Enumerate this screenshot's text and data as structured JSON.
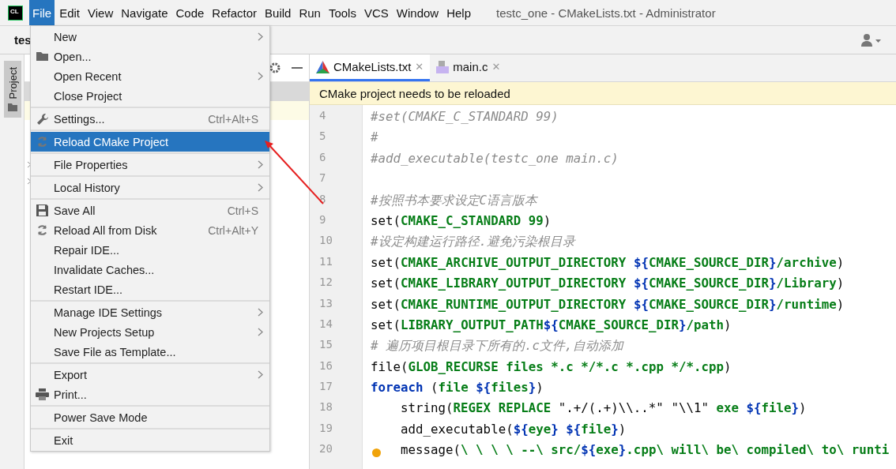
{
  "menu_bar": {
    "logo": "CL",
    "items": [
      {
        "label": "File",
        "selected": true
      },
      {
        "label": "Edit",
        "selected": false
      },
      {
        "label": "View",
        "selected": false
      },
      {
        "label": "Navigate",
        "selected": false
      },
      {
        "label": "Code",
        "selected": false
      },
      {
        "label": "Refactor",
        "selected": false
      },
      {
        "label": "Build",
        "selected": false
      },
      {
        "label": "Run",
        "selected": false
      },
      {
        "label": "Tools",
        "selected": false
      },
      {
        "label": "VCS",
        "selected": false
      },
      {
        "label": "Window",
        "selected": false
      },
      {
        "label": "Help",
        "selected": false
      }
    ],
    "window_title": "testc_one - CMakeLists.txt - Administrator"
  },
  "toolbar": {
    "project_name": "tes"
  },
  "side_strip": {
    "label": "Project"
  },
  "file_menu": {
    "sections": [
      [
        {
          "label": "New",
          "kind": "none",
          "submenu": true,
          "selected": false
        },
        {
          "label": "Open...",
          "kind": "folder",
          "submenu": false,
          "selected": false
        },
        {
          "label": "Open Recent",
          "kind": "none",
          "submenu": true,
          "selected": false
        },
        {
          "label": "Close Project",
          "kind": "none",
          "submenu": false,
          "selected": false
        }
      ],
      [
        {
          "label": "Settings...",
          "kind": "wrench",
          "shortcut": "Ctrl+Alt+S",
          "submenu": false,
          "selected": false
        }
      ],
      [
        {
          "label": "Reload CMake Project",
          "kind": "reload",
          "submenu": false,
          "selected": true
        }
      ],
      [
        {
          "label": "File Properties",
          "kind": "none",
          "submenu": true,
          "selected": false
        }
      ],
      [
        {
          "label": "Local History",
          "kind": "none",
          "submenu": true,
          "selected": false
        }
      ],
      [
        {
          "label": "Save All",
          "kind": "save",
          "shortcut": "Ctrl+S",
          "submenu": false,
          "selected": false
        },
        {
          "label": "Reload All from Disk",
          "kind": "reload",
          "shortcut": "Ctrl+Alt+Y",
          "submenu": false,
          "selected": false
        },
        {
          "label": "Repair IDE...",
          "kind": "none",
          "submenu": false,
          "selected": false
        },
        {
          "label": "Invalidate Caches...",
          "kind": "none",
          "submenu": false,
          "selected": false
        },
        {
          "label": "Restart IDE...",
          "kind": "none",
          "submenu": false,
          "selected": false
        }
      ],
      [
        {
          "label": "Manage IDE Settings",
          "kind": "none",
          "submenu": true,
          "selected": false
        },
        {
          "label": "New Projects Setup",
          "kind": "none",
          "submenu": true,
          "selected": false
        },
        {
          "label": "Save File as Template...",
          "kind": "none",
          "submenu": false,
          "selected": false
        }
      ],
      [
        {
          "label": "Export",
          "kind": "none",
          "submenu": true,
          "selected": false
        },
        {
          "label": "Print...",
          "kind": "printer",
          "submenu": false,
          "selected": false
        }
      ],
      [
        {
          "label": "Power Save Mode",
          "kind": "none",
          "submenu": false,
          "selected": false
        }
      ],
      [
        {
          "label": "Exit",
          "kind": "none",
          "submenu": false,
          "selected": false
        }
      ]
    ]
  },
  "editor": {
    "tabs": [
      {
        "label": "CMakeLists.txt",
        "kind": "cmake",
        "selected": true,
        "close": "✕"
      },
      {
        "label": "main.c",
        "kind": "c",
        "selected": false,
        "close": "✕"
      }
    ],
    "banner": "CMake project needs to be reloaded",
    "lines": [
      {
        "number": "4",
        "indented": false,
        "marker": false,
        "segments": [
          {
            "kind": "comment",
            "text": "#set(CMAKE_C_STANDARD 99)"
          }
        ]
      },
      {
        "number": "5",
        "indented": false,
        "marker": false,
        "segments": [
          {
            "kind": "comment",
            "text": "#"
          }
        ]
      },
      {
        "number": "6",
        "indented": false,
        "marker": false,
        "segments": [
          {
            "kind": "comment",
            "text": "#add_executable(testc_one main.c)"
          }
        ]
      },
      {
        "number": "7",
        "marker": false
      },
      {
        "number": "8",
        "indented": false,
        "marker": false,
        "segments": [
          {
            "kind": "comment",
            "text": "#按照书本要求设定C语言版本"
          }
        ]
      },
      {
        "number": "9",
        "indented": false,
        "marker": false,
        "segments": [
          {
            "kind": "plain",
            "text": "set("
          },
          {
            "kind": "arg",
            "text": "CMAKE_C_STANDARD 99"
          },
          {
            "kind": "plain",
            "text": ")"
          }
        ]
      },
      {
        "number": "10",
        "indented": false,
        "marker": false,
        "segments": [
          {
            "kind": "comment",
            "text": "#设定构建运行路径.避免污染根目录"
          }
        ]
      },
      {
        "number": "11",
        "indented": false,
        "marker": false,
        "segments": [
          {
            "kind": "plain",
            "text": "set("
          },
          {
            "kind": "arg",
            "text": "CMAKE_ARCHIVE_OUTPUT_DIRECTORY "
          },
          {
            "kind": "var",
            "text": "${"
          },
          {
            "kind": "arg",
            "text": "CMAKE_SOURCE_DIR"
          },
          {
            "kind": "var",
            "text": "}"
          },
          {
            "kind": "arg",
            "text": "/archive"
          },
          {
            "kind": "plain",
            "text": ")"
          }
        ]
      },
      {
        "number": "12",
        "indented": false,
        "marker": false,
        "segments": [
          {
            "kind": "plain",
            "text": "set("
          },
          {
            "kind": "arg",
            "text": "CMAKE_LIBRARY_OUTPUT_DIRECTORY "
          },
          {
            "kind": "var",
            "text": "${"
          },
          {
            "kind": "arg",
            "text": "CMAKE_SOURCE_DIR"
          },
          {
            "kind": "var",
            "text": "}"
          },
          {
            "kind": "arg",
            "text": "/Library"
          },
          {
            "kind": "plain",
            "text": ")"
          }
        ]
      },
      {
        "number": "13",
        "indented": false,
        "marker": false,
        "segments": [
          {
            "kind": "plain",
            "text": "set("
          },
          {
            "kind": "arg",
            "text": "CMAKE_RUNTIME_OUTPUT_DIRECTORY "
          },
          {
            "kind": "var",
            "text": "${"
          },
          {
            "kind": "arg",
            "text": "CMAKE_SOURCE_DIR"
          },
          {
            "kind": "var",
            "text": "}"
          },
          {
            "kind": "arg",
            "text": "/runtime"
          },
          {
            "kind": "plain",
            "text": ")"
          }
        ]
      },
      {
        "number": "14",
        "indented": false,
        "marker": false,
        "segments": [
          {
            "kind": "plain",
            "text": "set("
          },
          {
            "kind": "arg",
            "text": "LIBRARY_OUTPUT_PATH"
          },
          {
            "kind": "var",
            "text": "${"
          },
          {
            "kind": "arg",
            "text": "CMAKE_SOURCE_DIR"
          },
          {
            "kind": "var",
            "text": "}"
          },
          {
            "kind": "arg",
            "text": "/path"
          },
          {
            "kind": "plain",
            "text": ")"
          }
        ]
      },
      {
        "number": "15",
        "indented": false,
        "marker": false,
        "segments": [
          {
            "kind": "comment",
            "text": "# 遍历项目根目录下所有的.c文件,自动添加"
          }
        ]
      },
      {
        "number": "16",
        "indented": false,
        "marker": false,
        "segments": [
          {
            "kind": "plain",
            "text": "file("
          },
          {
            "kind": "arg",
            "text": "GLOB_RECURSE files *.c */*.c *.cpp */*.cpp"
          },
          {
            "kind": "plain",
            "text": ")"
          }
        ]
      },
      {
        "number": "17",
        "indented": false,
        "marker": false,
        "segments": [
          {
            "kind": "keyword",
            "text": "foreach"
          },
          {
            "kind": "plain",
            "text": " ("
          },
          {
            "kind": "arg",
            "text": "file "
          },
          {
            "kind": "var",
            "text": "${"
          },
          {
            "kind": "arg",
            "text": "files"
          },
          {
            "kind": "var",
            "text": "}"
          },
          {
            "kind": "plain",
            "text": ")"
          }
        ]
      },
      {
        "number": "18",
        "indented": true,
        "marker": false,
        "segments": [
          {
            "kind": "plain",
            "text": "string("
          },
          {
            "kind": "arg",
            "text": "REGEX REPLACE "
          },
          {
            "kind": "plain",
            "text": "\".+/(.+)\\\\..*\" \"\\\\1\" "
          },
          {
            "kind": "arg",
            "text": "exe "
          },
          {
            "kind": "var",
            "text": "${"
          },
          {
            "kind": "arg",
            "text": "file"
          },
          {
            "kind": "var",
            "text": "}"
          },
          {
            "kind": "plain",
            "text": ")"
          }
        ]
      },
      {
        "number": "19",
        "indented": true,
        "marker": false,
        "segments": [
          {
            "kind": "plain",
            "text": "add_executable("
          },
          {
            "kind": "var",
            "text": "${"
          },
          {
            "kind": "arg",
            "text": "eye"
          },
          {
            "kind": "var",
            "text": "} ${"
          },
          {
            "kind": "arg",
            "text": "file"
          },
          {
            "kind": "var",
            "text": "}"
          },
          {
            "kind": "plain",
            "text": ")"
          }
        ]
      },
      {
        "number": "20",
        "indented": true,
        "marker": true,
        "segments": [
          {
            "kind": "plain",
            "text": "message("
          },
          {
            "kind": "arg",
            "text": "\\ \\ \\ \\ --\\ src/"
          },
          {
            "kind": "var",
            "text": "${"
          },
          {
            "kind": "arg",
            "text": "exe"
          },
          {
            "kind": "var",
            "text": "}"
          },
          {
            "kind": "arg",
            "text": ".cpp\\ will\\ be\\ compiled\\ to\\ runti"
          }
        ]
      }
    ]
  }
}
